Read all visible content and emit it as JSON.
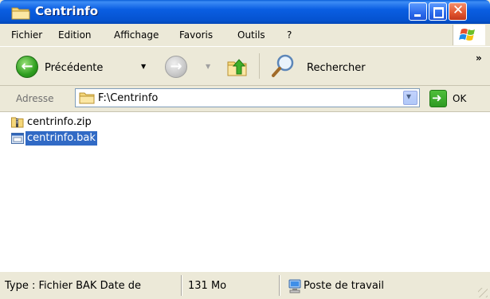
{
  "window": {
    "title": "Centrinfo",
    "close_glyph": "✕"
  },
  "menu": {
    "items": [
      "Fichier",
      "Edition",
      "Affichage",
      "Favoris",
      "Outils",
      "?"
    ]
  },
  "toolbar": {
    "back_label": "Précédente",
    "back_arrow": "←",
    "forward_arrow": "→",
    "search_label": "Rechercher",
    "more_glyph": "»"
  },
  "address": {
    "label": "Adresse",
    "path": "F:\\Centrinfo",
    "go_label": "OK"
  },
  "files": [
    {
      "name": "centrinfo.zip",
      "icon": "zip-folder-icon",
      "selected": false
    },
    {
      "name": "centrinfo.bak",
      "icon": "bak-file-icon",
      "selected": true
    }
  ],
  "status": {
    "type_text": "Type : Fichier BAK Date de",
    "size_text": "131 Mo",
    "location_text": "Poste de travail"
  },
  "colors": {
    "titlebar": "#0A5EE2",
    "selection": "#316AC5",
    "background": "#ECE9D8"
  }
}
